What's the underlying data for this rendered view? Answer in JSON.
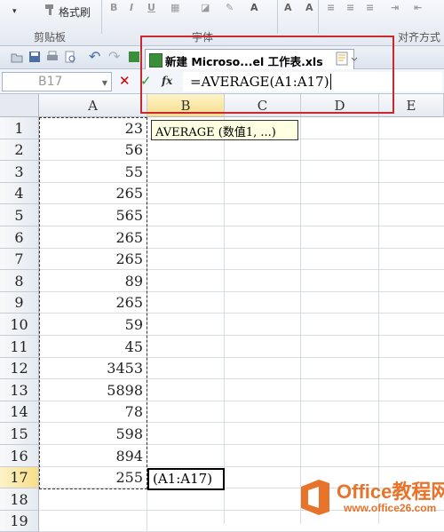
{
  "ribbon": {
    "format_painter_label": "格式刷",
    "groups": [
      "剪贴板",
      "字体",
      "对齐方式"
    ]
  },
  "document_tab": {
    "title": "新建 Microso...el 工作表.xls",
    "close_glyph": "×"
  },
  "formula_bar": {
    "name_box": "B17",
    "cancel_glyph": "✕",
    "enter_glyph": "✓",
    "fx_label": "fx",
    "formula": "=AVERAGE(A1:A17)"
  },
  "sheet": {
    "columns": [
      "A",
      "B",
      "C",
      "D",
      "E"
    ],
    "rows": [
      {
        "n": "1",
        "a": "23"
      },
      {
        "n": "2",
        "a": "56"
      },
      {
        "n": "3",
        "a": "55"
      },
      {
        "n": "4",
        "a": "265"
      },
      {
        "n": "5",
        "a": "565"
      },
      {
        "n": "6",
        "a": "265"
      },
      {
        "n": "7",
        "a": "265"
      },
      {
        "n": "8",
        "a": "89"
      },
      {
        "n": "9",
        "a": "265"
      },
      {
        "n": "10",
        "a": "59"
      },
      {
        "n": "11",
        "a": "45"
      },
      {
        "n": "12",
        "a": "3453"
      },
      {
        "n": "13",
        "a": "5898"
      },
      {
        "n": "14",
        "a": "78"
      },
      {
        "n": "15",
        "a": "598"
      },
      {
        "n": "16",
        "a": "894"
      },
      {
        "n": "17",
        "a": "255"
      },
      {
        "n": "18",
        "a": ""
      },
      {
        "n": "19",
        "a": ""
      }
    ],
    "tooltip": "AVERAGE (数值1, ...)",
    "active_cell_text": "(A1:A17)"
  },
  "watermark": {
    "brand": "Office教程网",
    "url": "www.office26.com"
  },
  "colors": {
    "highlight": "#c8282e",
    "watermark": "#e8732a",
    "selected_header": "#f6dd8a"
  }
}
